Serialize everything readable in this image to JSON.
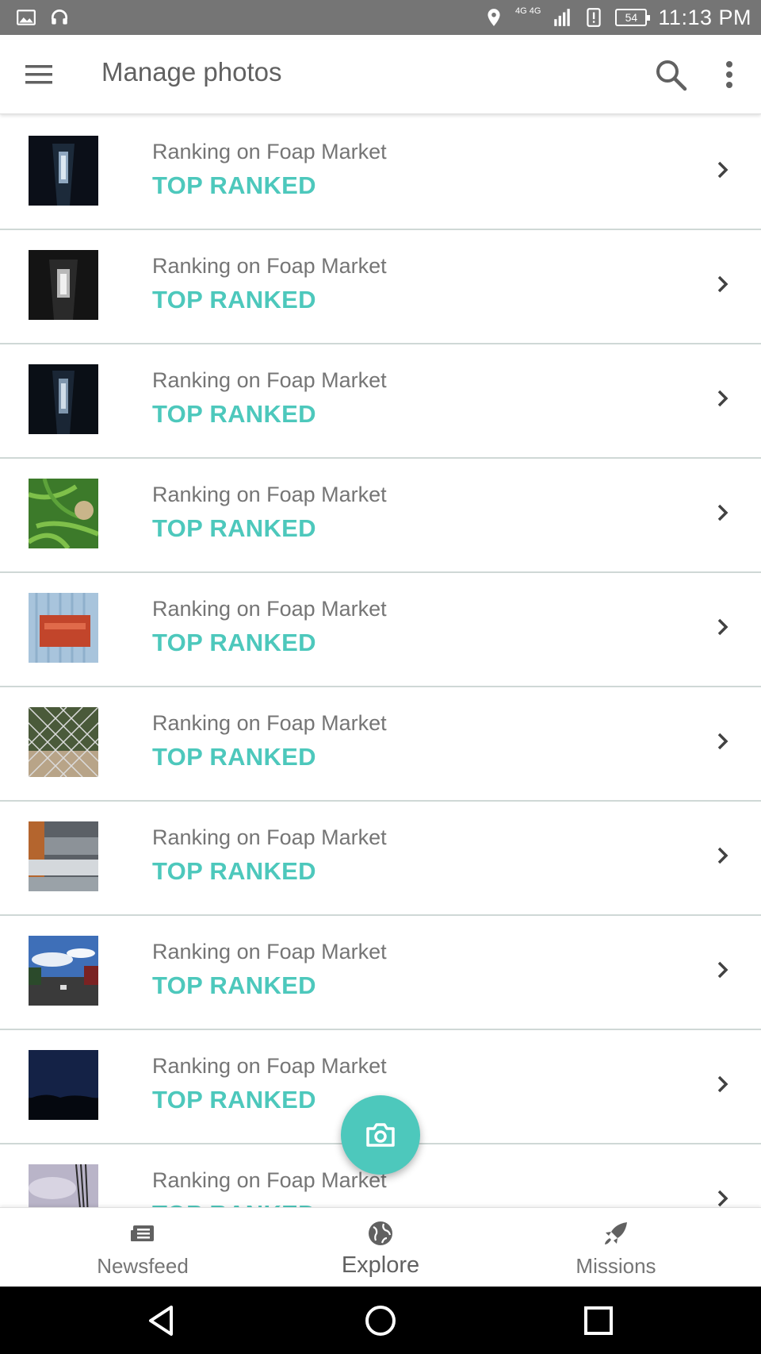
{
  "status_bar": {
    "time": "11:13 PM",
    "battery": "54",
    "network": "4G 4G",
    "icons_left": [
      "image-icon",
      "headset-icon"
    ],
    "icons_right": [
      "location-icon",
      "signal-icon",
      "alert-icon",
      "battery-icon"
    ]
  },
  "app_bar": {
    "title": "Manage photos",
    "icons": [
      "menu-icon",
      "search-icon",
      "more-vert-icon"
    ]
  },
  "list": {
    "items": [
      {
        "label": "Ranking on Foap Market",
        "status": "TOP RANKED",
        "thumb": "dark corridor"
      },
      {
        "label": "Ranking on Foap Market",
        "status": "TOP RANKED",
        "thumb": "dark corridor"
      },
      {
        "label": "Ranking on Foap Market",
        "status": "TOP RANKED",
        "thumb": "dark corridor"
      },
      {
        "label": "Ranking on Foap Market",
        "status": "TOP RANKED",
        "thumb": "green leaves"
      },
      {
        "label": "Ranking on Foap Market",
        "status": "TOP RANKED",
        "thumb": "red mailbox"
      },
      {
        "label": "Ranking on Foap Market",
        "status": "TOP RANKED",
        "thumb": "chain fence"
      },
      {
        "label": "Ranking on Foap Market",
        "status": "TOP RANKED",
        "thumb": "window reflection"
      },
      {
        "label": "Ranking on Foap Market",
        "status": "TOP RANKED",
        "thumb": "city street"
      },
      {
        "label": "Ranking on Foap Market",
        "status": "TOP RANKED",
        "thumb": "night sky"
      },
      {
        "label": "Ranking on Foap Market",
        "status": "TOP RANKED",
        "thumb": "power lines"
      }
    ]
  },
  "fab": {
    "icon": "camera-icon"
  },
  "bottom_nav": {
    "items": [
      {
        "label": "Newsfeed",
        "icon": "newsfeed-icon",
        "active": false
      },
      {
        "label": "Explore",
        "icon": "globe-icon",
        "active": true
      },
      {
        "label": "Missions",
        "icon": "rocket-icon",
        "active": false
      }
    ]
  },
  "colors": {
    "accent": "#4dc8bc",
    "status_bar": "#757575",
    "text_secondary": "#757575",
    "divider": "#cfd8d6"
  }
}
